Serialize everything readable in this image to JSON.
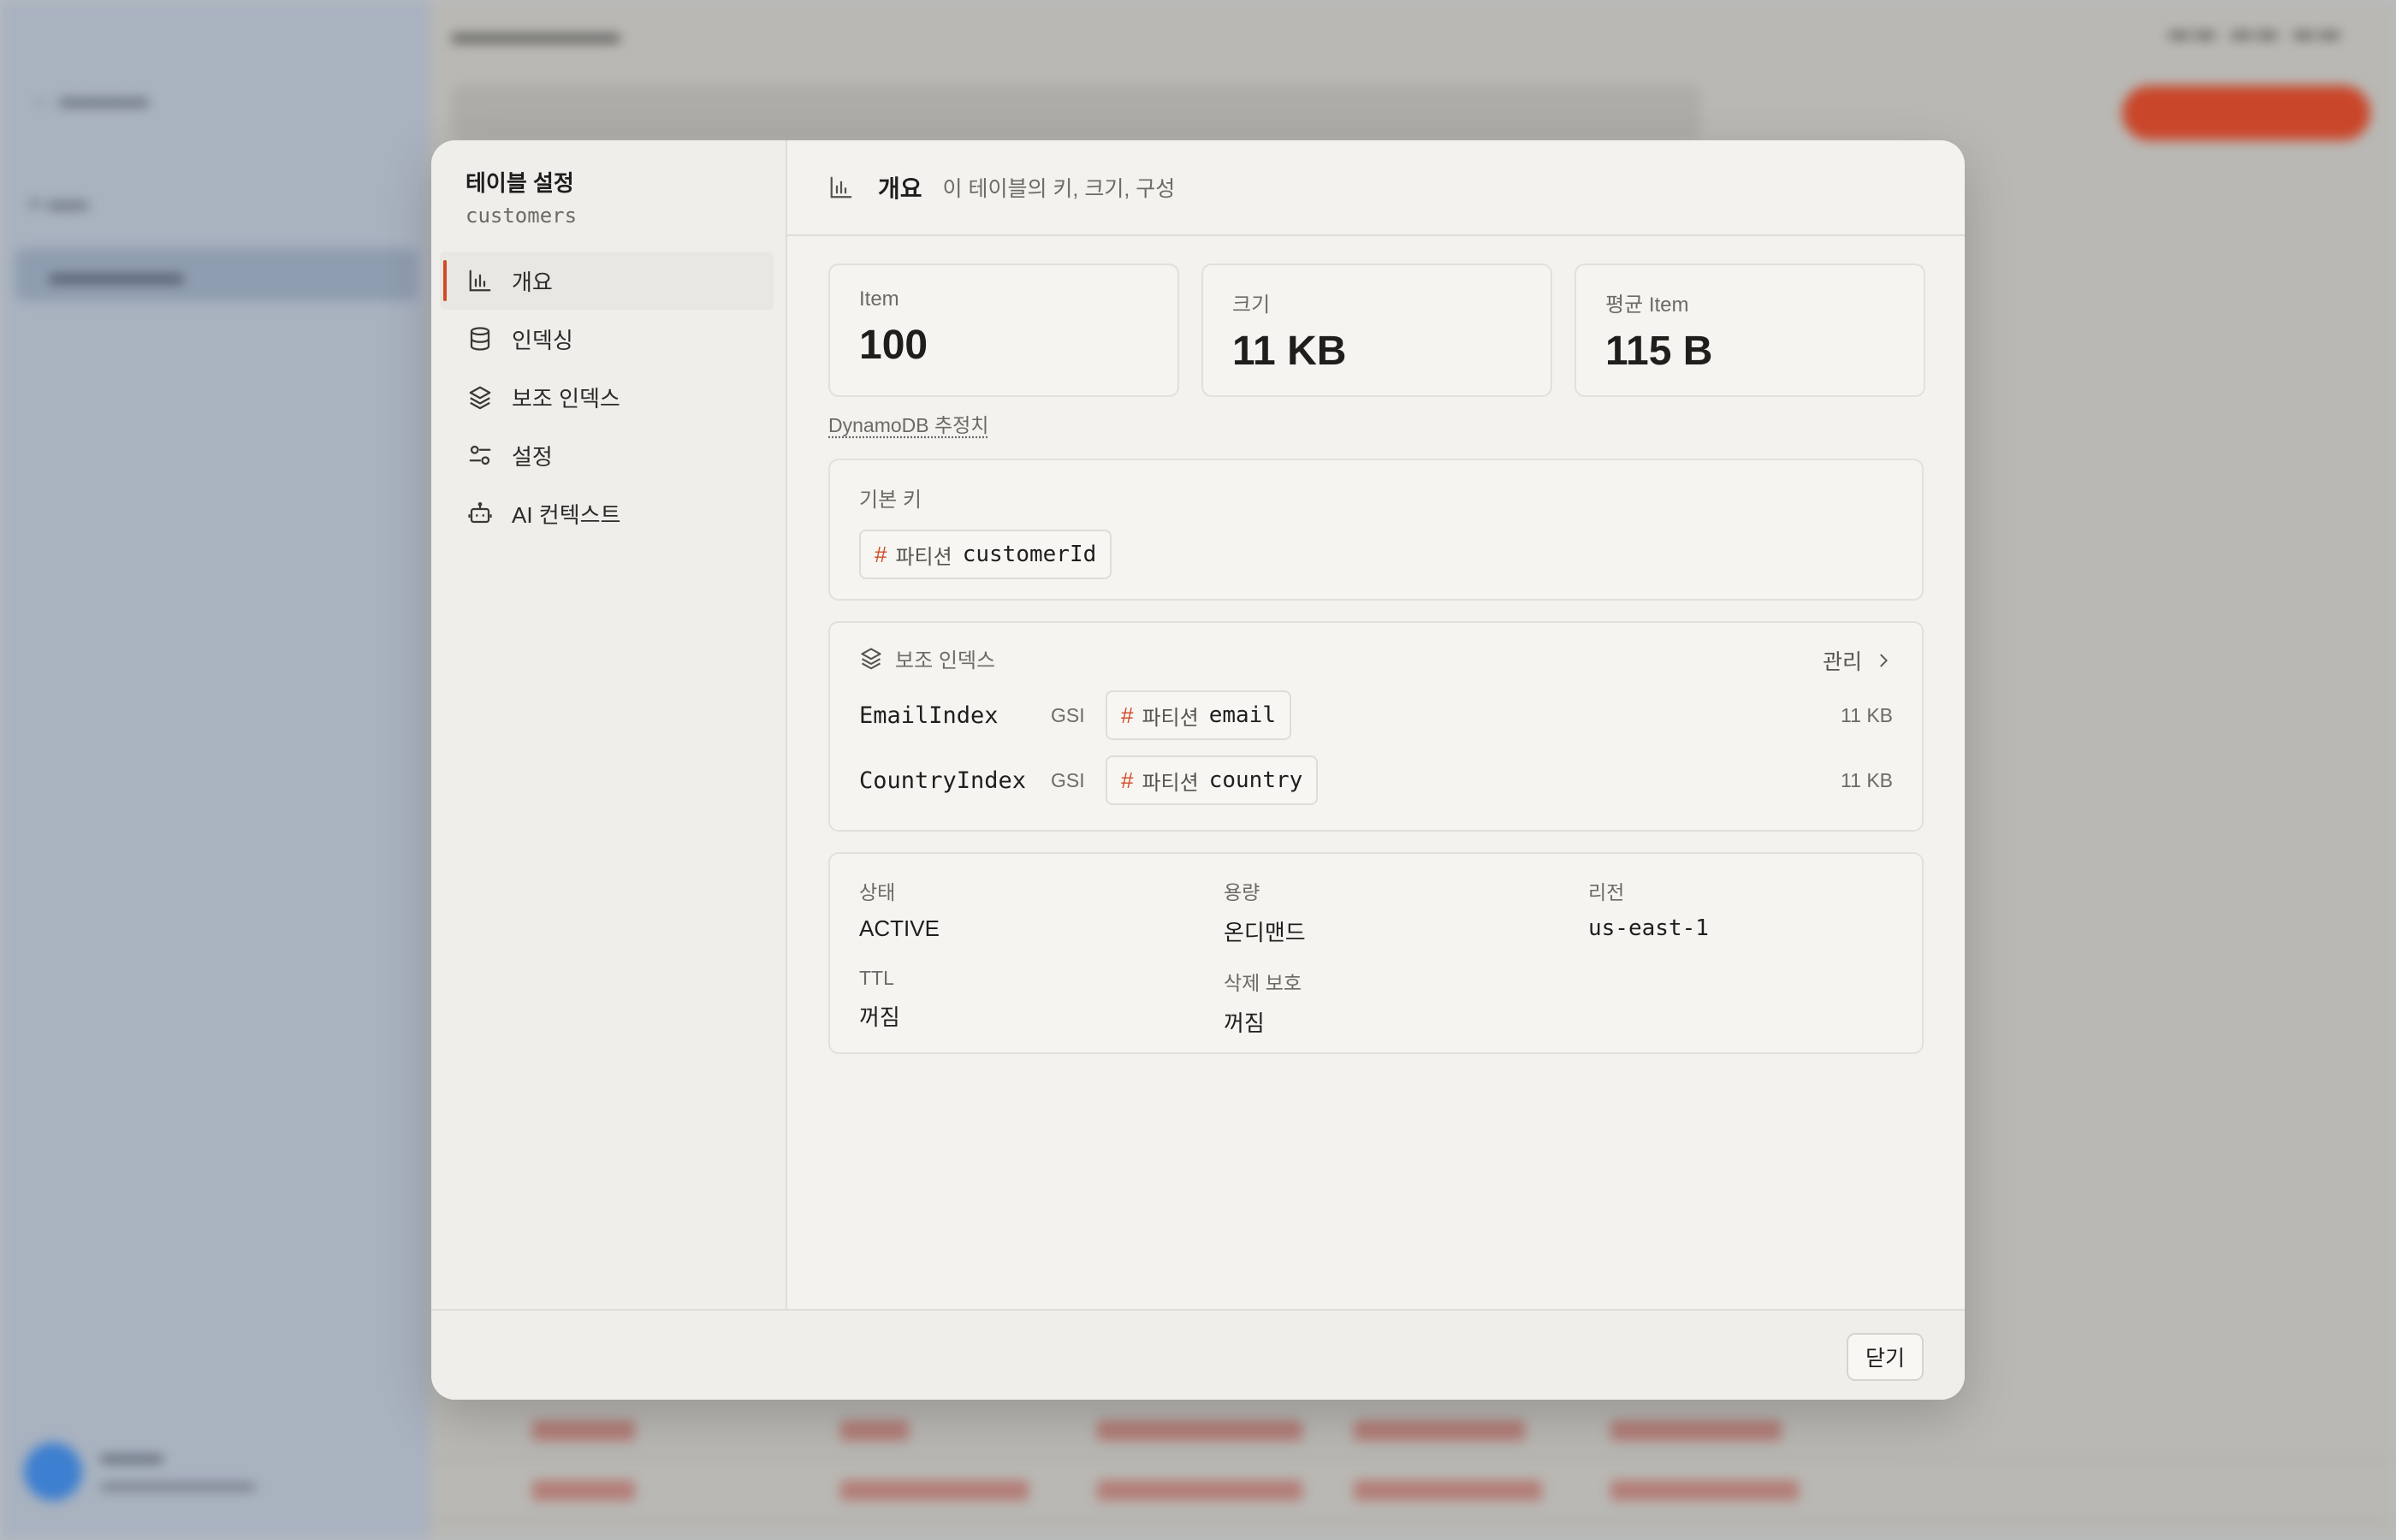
{
  "modal": {
    "title": "테이블 설정",
    "table_name": "customers",
    "nav": [
      {
        "label": "개요",
        "icon": "bar-chart-icon",
        "active": true
      },
      {
        "label": "인덱싱",
        "icon": "database-icon",
        "active": false
      },
      {
        "label": "보조 인덱스",
        "icon": "layers-icon",
        "active": false
      },
      {
        "label": "설정",
        "icon": "sliders-icon",
        "active": false
      },
      {
        "label": "AI 컨텍스트",
        "icon": "robot-icon",
        "active": false
      }
    ],
    "header": {
      "title": "개요",
      "description": "이 테이블의 키, 크기, 구성"
    },
    "stats": [
      {
        "label": "Item",
        "value": "100"
      },
      {
        "label": "크기",
        "value": "11 KB"
      },
      {
        "label": "평균 Item",
        "value": "115 B"
      }
    ],
    "estimate_note": "DynamoDB 추정치",
    "primary_key": {
      "label": "기본 키",
      "type": "파티션",
      "name": "customerId"
    },
    "secondary_indexes": {
      "label": "보조 인덱스",
      "manage_label": "관리",
      "items": [
        {
          "name": "EmailIndex",
          "type": "GSI",
          "key_type": "파티션",
          "key_name": "email",
          "size": "11 KB"
        },
        {
          "name": "CountryIndex",
          "type": "GSI",
          "key_type": "파티션",
          "key_name": "country",
          "size": "11 KB"
        }
      ]
    },
    "details": {
      "status": {
        "label": "상태",
        "value": "ACTIVE"
      },
      "capacity": {
        "label": "용량",
        "value": "온디맨드"
      },
      "region": {
        "label": "리전",
        "value": "us-east-1"
      },
      "ttl": {
        "label": "TTL",
        "value": "꺼짐"
      },
      "deletion_protection": {
        "label": "삭제 보호",
        "value": "꺼짐"
      }
    },
    "close_label": "닫기"
  },
  "colors": {
    "accent": "#d24a25",
    "modal_bg": "#f3f2ef"
  }
}
